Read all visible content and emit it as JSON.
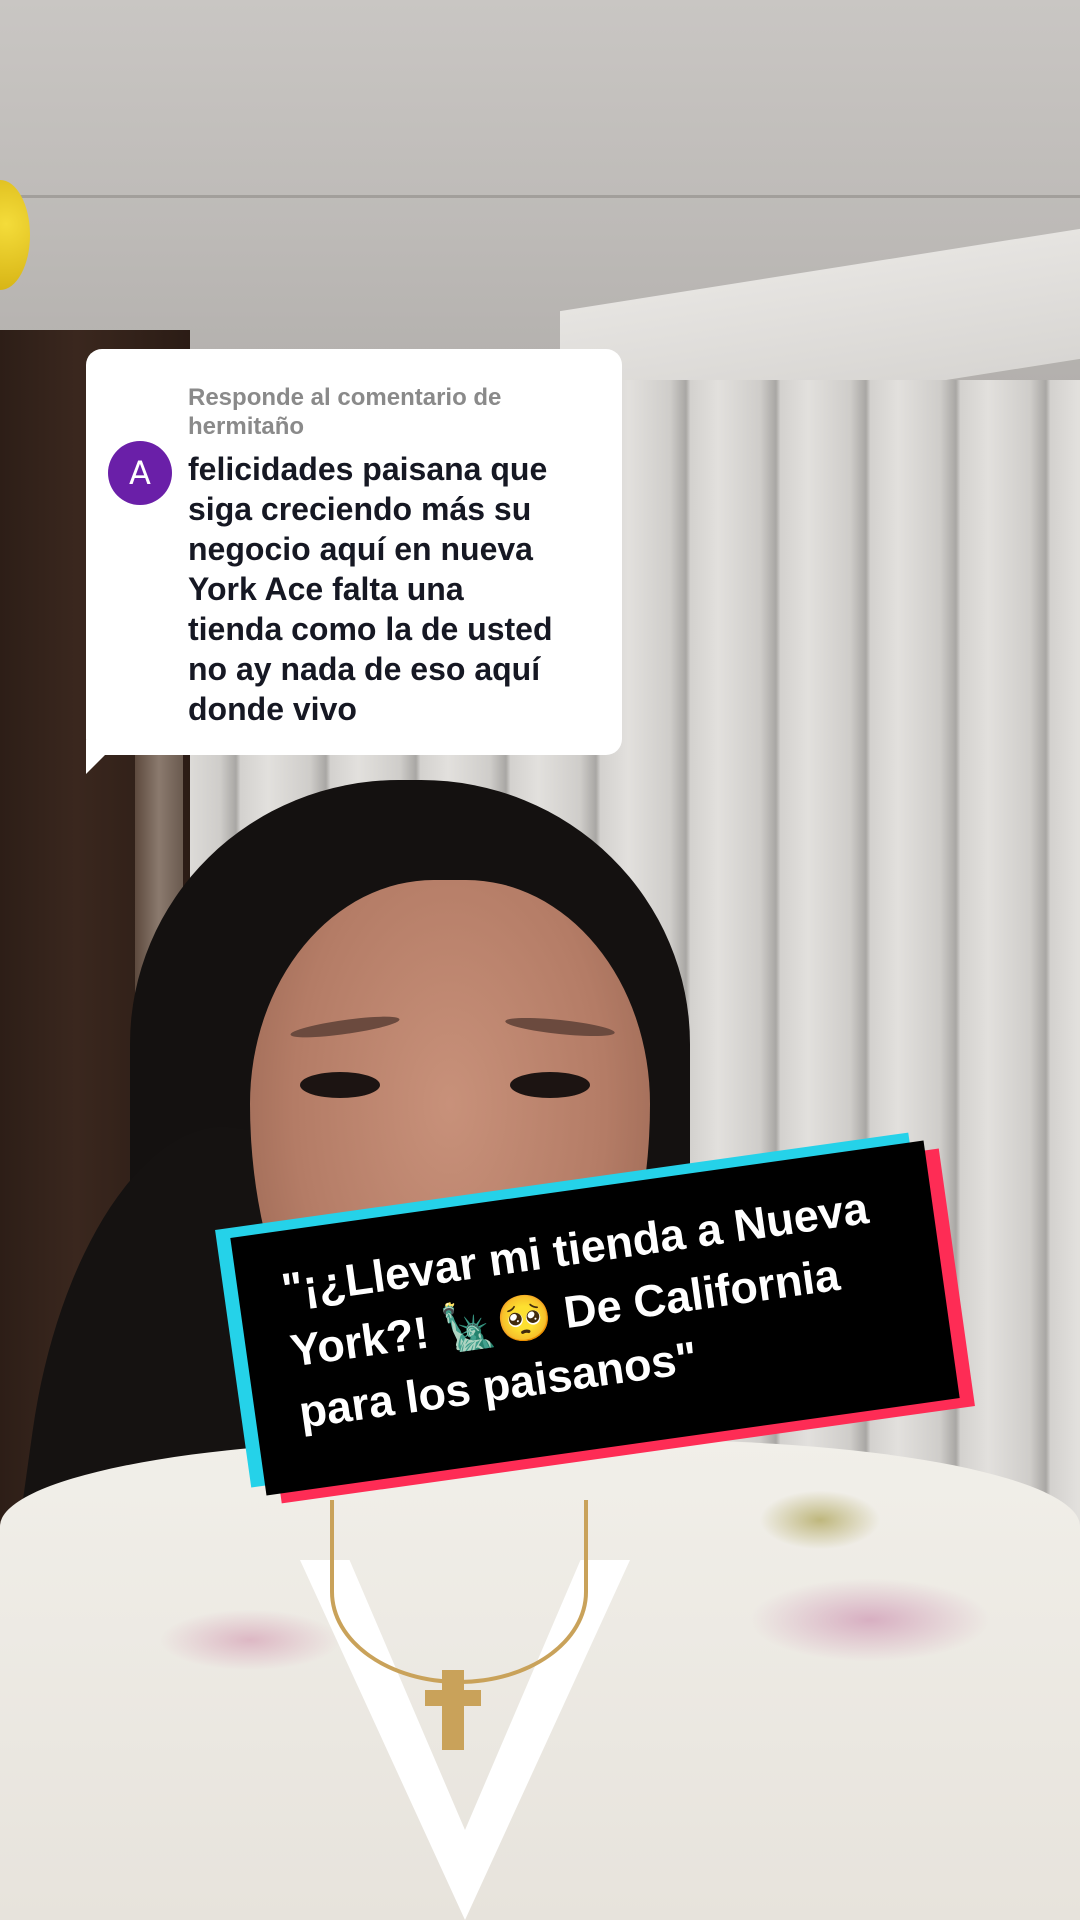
{
  "reply": {
    "header_line1": "Responde al comentario de",
    "header_line2": "hermitaño",
    "avatar_initial": "A",
    "avatar_color": "#6a1fa8",
    "comment_text": "felicidades paisana que\nsiga creciendo más su\nnegocio aquí en nueva\nYork Ace falta una\ntienda como la de usted\nno ay nada de eso aquí\ndonde vivo"
  },
  "caption": {
    "line1": "\"¡¿Llevar mi tienda a Nueva",
    "line2": "York?! 🗽🥺 De California",
    "line3": "para los paisanos\"",
    "accent_cyan": "#25d2e9",
    "accent_red": "#fe2c55"
  }
}
